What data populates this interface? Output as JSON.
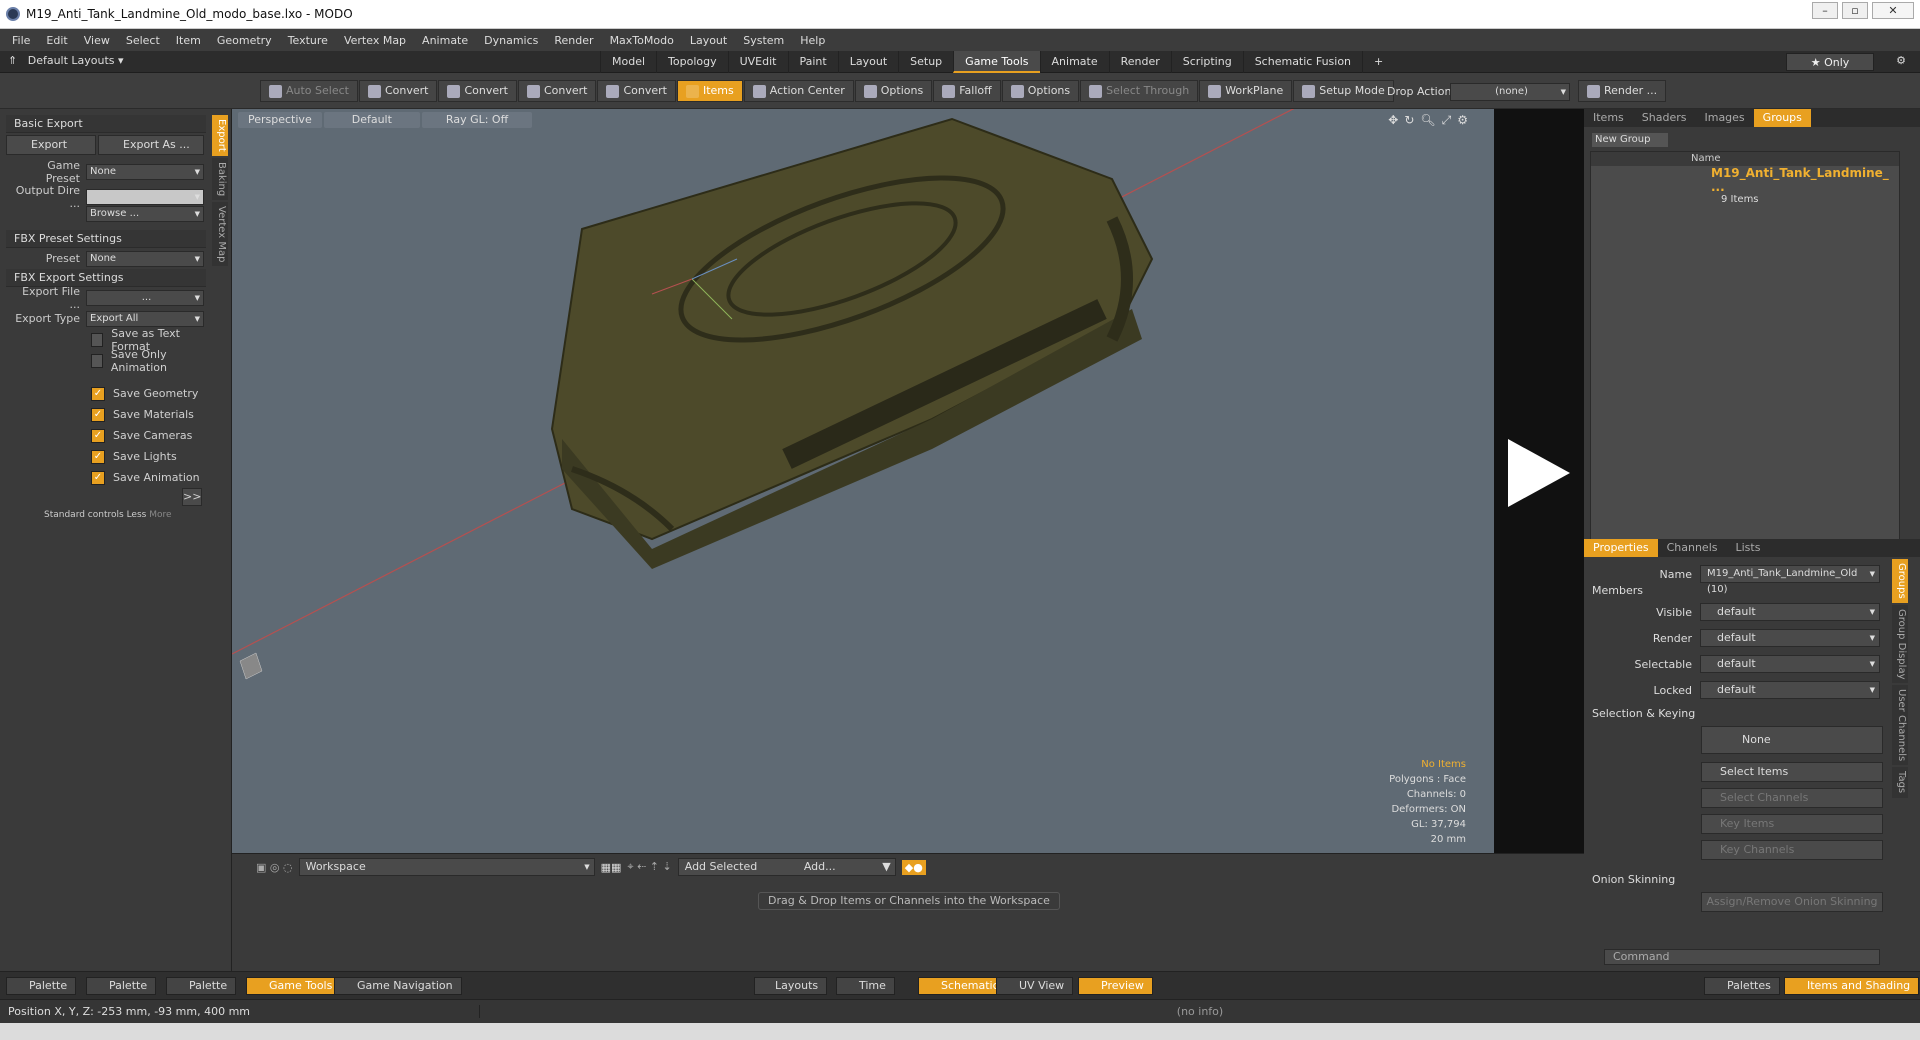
{
  "window": {
    "title": "M19_Anti_Tank_Landmine_Old_modo_base.lxo - MODO"
  },
  "menu": [
    "File",
    "Edit",
    "View",
    "Select",
    "Item",
    "Geometry",
    "Texture",
    "Vertex Map",
    "Animate",
    "Dynamics",
    "Render",
    "MaxToModo",
    "Layout",
    "System",
    "Help"
  ],
  "layout": {
    "dropdown": "Default Layouts",
    "tabs": [
      "Model",
      "Topology",
      "UVEdit",
      "Paint",
      "Layout",
      "Setup",
      "Game Tools",
      "Animate",
      "Render",
      "Scripting",
      "Schematic Fusion"
    ],
    "active_tab": "Game Tools",
    "plus": "+",
    "only": "Only"
  },
  "toolbar": {
    "items": [
      {
        "label": "Auto Select",
        "state": "dim"
      },
      {
        "label": "Convert",
        "state": ""
      },
      {
        "label": "Convert",
        "state": ""
      },
      {
        "label": "Convert",
        "state": ""
      },
      {
        "label": "Convert",
        "state": ""
      },
      {
        "label": "Items",
        "state": "orange"
      },
      {
        "label": "Action Center",
        "state": ""
      },
      {
        "label": "Options",
        "state": ""
      },
      {
        "label": "Falloff",
        "state": ""
      },
      {
        "label": "Options",
        "state": ""
      },
      {
        "label": "Select Through",
        "state": "dim"
      },
      {
        "label": "WorkPlane",
        "state": ""
      },
      {
        "label": "Setup Mode",
        "state": ""
      }
    ],
    "drop_action_label": "Drop Action",
    "drop_action_value": "(none)",
    "render": "Render ..."
  },
  "left": {
    "basic_export": "Basic Export",
    "export": "Export",
    "export_as": "Export As ...",
    "game_preset_label": "Game Preset",
    "game_preset": "None",
    "output_dir_label": "Output Dire ...",
    "browse": "Browse ...",
    "fbx_preset": "FBX Preset Settings",
    "preset_label": "Preset",
    "preset": "None",
    "fbx_export": "FBX Export Settings",
    "export_file_label": "Export File ...",
    "export_file": "...",
    "export_type_label": "Export Type",
    "export_type": "Export All",
    "checks": [
      {
        "label": "Save as Text Format",
        "on": false
      },
      {
        "label": "Save Only Animation",
        "on": false
      },
      {
        "label": "Save Geometry",
        "on": true
      },
      {
        "label": "Save Materials",
        "on": true
      },
      {
        "label": "Save Cameras",
        "on": true
      },
      {
        "label": "Save Lights",
        "on": true
      },
      {
        "label": "Save Animation",
        "on": true
      }
    ],
    "more_btn": ">>",
    "std": "Standard controls",
    "less": "Less",
    "more": "More",
    "vtabs": [
      "Export",
      "Baking",
      "Vertex Map"
    ]
  },
  "viewport": {
    "view": "Perspective",
    "shading": "Default",
    "raygl": "Ray GL: Off",
    "info": [
      "No Items",
      "Polygons : Face",
      "Channels: 0",
      "Deformers: ON",
      "GL: 37,794",
      "20 mm"
    ]
  },
  "right": {
    "tabs": [
      "Items",
      "Shaders",
      "Images",
      "Groups"
    ],
    "active": "Groups",
    "new_group": "New Group",
    "name_col": "Name",
    "group_name": "M19_Anti_Tank_Landmine_ ...",
    "group_count": "9 Items",
    "prop_tabs": [
      "Properties",
      "Channels",
      "Lists"
    ],
    "name_label": "Name",
    "name_value": "M19_Anti_Tank_Landmine_Old (10)",
    "members": "Members",
    "visible": "default",
    "render": "default",
    "selectable": "default",
    "locked": "default",
    "sel_key": "Selection & Keying",
    "none": "None",
    "select_items": "Select Items",
    "select_channels": "Select Channels",
    "key_items": "Key Items",
    "key_channels": "Key Channels",
    "onion": "Onion Skinning",
    "assign_onion": "Assign/Remove Onion Skinning",
    "command": "Command",
    "vtabs": [
      "Groups",
      "Group Display",
      "User Channels",
      "Tags"
    ],
    "labels": {
      "visible": "Visible",
      "render": "Render",
      "selectable": "Selectable",
      "locked": "Locked"
    }
  },
  "schematic": {
    "workspace": "Workspace",
    "add_selected": "Add Selected",
    "add": "Add...",
    "drag_note": "Drag & Drop Items or Channels into the Workspace"
  },
  "bottom": {
    "palettes": [
      "Palette",
      "Palette",
      "Palette"
    ],
    "game_tools": "Game Tools",
    "game_nav": "Game Navigation",
    "layouts": "Layouts",
    "time": "Time",
    "schematic": "Schematic",
    "uv_view": "UV View",
    "preview": "Preview",
    "palettes_btn": "Palettes",
    "items_shading": "Items and Shading"
  },
  "status": {
    "position": "Position X, Y, Z:  -253 mm, -93 mm, 400 mm",
    "info": "(no info)"
  }
}
